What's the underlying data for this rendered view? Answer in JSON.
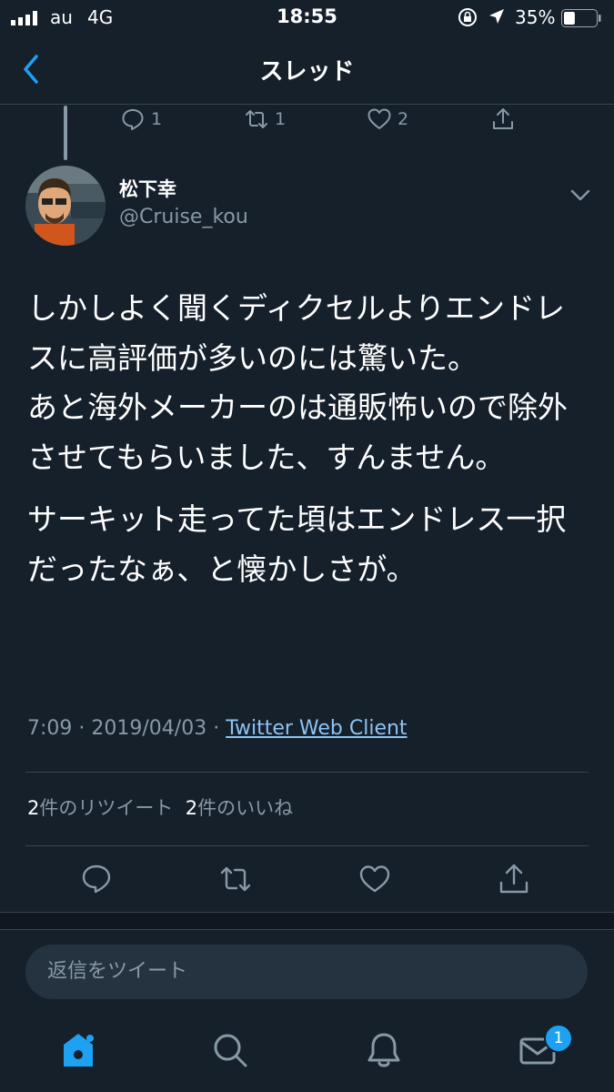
{
  "status_bar": {
    "carrier": "au",
    "network": "4G",
    "time": "18:55",
    "battery": "35%",
    "battery_level": 0.35
  },
  "nav": {
    "title": "スレッド",
    "back_icon": "chevron-left-icon"
  },
  "previous_tweet": {
    "replies": "1",
    "retweets": "1",
    "likes": "2"
  },
  "tweet": {
    "author_name": "松下幸",
    "handle": "@Cruise_kou",
    "paragraphs": [
      "しかしよく聞くディクセルよりエンドレスに高評価が多いのには驚いた。\nあと海外メーカーのは通販怖いので除外させてもらいました、すんません。",
      "サーキット走ってた頃はエンドレス一択だったなぁ、と懐かしさが。"
    ],
    "time": "7:09",
    "date": "2019/04/03",
    "client": "Twitter Web Client",
    "retweet_count": "2",
    "retweet_label": "件のリツイート",
    "like_count": "2",
    "like_label": "件のいいね"
  },
  "reply_box": {
    "placeholder": "返信をツイート"
  },
  "tab_bar": {
    "messages_badge": "1"
  },
  "colors": {
    "background": "#15202b",
    "muted": "#8899a6",
    "accent": "#1da1f2",
    "divider": "#38444d"
  }
}
